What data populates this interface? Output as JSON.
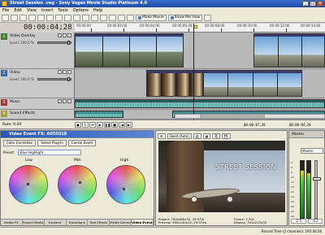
{
  "window": {
    "title": "Street Session .veg - Sony Vegas Movie Studio Platinum 4.0"
  },
  "menu": [
    "File",
    "Edit",
    "View",
    "Insert",
    "Tools",
    "Options",
    "Help"
  ],
  "toolbar": {
    "make_movie_label": "Make Movie",
    "show_me_how_label": "Show Me How"
  },
  "timeline": {
    "cursor_time": "00:00:04;28",
    "ruler_labels": [
      "00:00:00",
      "00:00:02;00",
      "00:00:04;00",
      "00:00:06;00",
      "00:00:08;00",
      "00:00:10;00",
      "00:00:12;00",
      "00:00:14;00"
    ],
    "tracks": [
      {
        "num": "1",
        "name": "Video Overlay",
        "level_label": "Level: 100.0 %",
        "color": "#4a7a3a",
        "kind": "video"
      },
      {
        "num": "2",
        "name": "Video",
        "level_label": "Level: 100.0 %",
        "color": "#3a6aa0",
        "kind": "video"
      },
      {
        "num": "3",
        "name": "Music",
        "level_label": "Vol: 0.0 dB",
        "color": "#a03a3a",
        "kind": "audio"
      },
      {
        "num": "4",
        "name": "Sound Effects",
        "level_label": "Vol: 0.0 dB",
        "color": "#a0a03a",
        "kind": "audio"
      }
    ]
  },
  "transport": {
    "rate": "Rate: 0.00",
    "time_a": "00:00:07;28",
    "time_b": "00:00:04;20"
  },
  "video_fx": {
    "title": "Video Event FX: A005018",
    "buttons": [
      "Color Correction",
      "Select Plug-In",
      "Cancel Event"
    ],
    "preset_label": "Preset:",
    "preset_value": "Blue Highlight",
    "wheels": [
      "Low",
      "Mid",
      "High"
    ],
    "tabs": [
      "Media FX",
      "Project Media",
      "Explorer",
      "Transitions",
      "Text Effects",
      "Media Generators",
      "Video Event FX"
    ],
    "active_tab": "Video Event FX"
  },
  "preview": {
    "title": "Video Preview",
    "quality": "Good (Auto)",
    "overlay_title": "STREET SESSION",
    "info": {
      "project": "Project: 720x480x32, 29.970i",
      "preview": "Preview: 360x240x32, 29.970p",
      "frame": "Frame: 2,391",
      "display": "Display: 341x213x32"
    }
  },
  "master": {
    "title": "Master",
    "bus_label": "Master",
    "scale": [
      "-3",
      "-6",
      "-9",
      "-12",
      "-15",
      "-18",
      "-21",
      "-24",
      "-30",
      "-36",
      "-42",
      "-48"
    ],
    "left_peak": "-2.5",
    "right_peak": "-3.2",
    "left_level": 0.82,
    "right_level": 0.78
  },
  "status": {
    "text": "Record Time (2 channels): 195:40:56"
  }
}
